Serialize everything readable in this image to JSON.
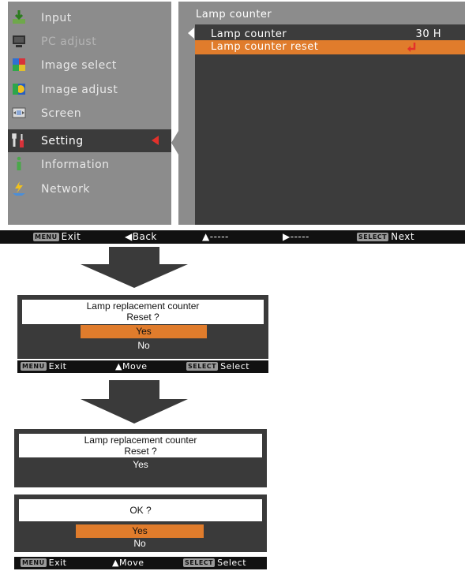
{
  "menu": {
    "items": [
      {
        "label": "Input",
        "icon": "input-icon",
        "state": "normal"
      },
      {
        "label": "PC adjust",
        "icon": "pc-adjust-icon",
        "state": "disabled"
      },
      {
        "label": "Image select",
        "icon": "image-select-icon",
        "state": "normal"
      },
      {
        "label": "Image adjust",
        "icon": "image-adjust-icon",
        "state": "normal"
      },
      {
        "label": "Screen",
        "icon": "screen-icon",
        "state": "normal"
      },
      {
        "label": "Setting",
        "icon": "setting-icon",
        "state": "active"
      },
      {
        "label": "Information",
        "icon": "information-icon",
        "state": "normal"
      },
      {
        "label": "Network",
        "icon": "network-icon",
        "state": "normal"
      }
    ]
  },
  "submenu": {
    "title": "Lamp counter",
    "rows": [
      {
        "label": "Lamp counter",
        "value": "30 H"
      },
      {
        "label": "Lamp counter  reset",
        "value": ""
      }
    ]
  },
  "status_bar": {
    "exit_key": "MENU",
    "exit_label": "Exit",
    "back_label": "Back",
    "updown_label": "-----",
    "right_label": "-----",
    "next_key": "SELECT",
    "next_label": "Next"
  },
  "dialog1": {
    "line1": "Lamp replacement counter",
    "line2": "Reset ?",
    "options": [
      "Yes",
      "No"
    ],
    "status": {
      "exit_key": "MENU",
      "exit_label": "Exit",
      "move_label": "Move",
      "select_key": "SELECT",
      "select_label": "Select"
    }
  },
  "dialog2": {
    "line1": "Lamp replacement counter",
    "line2": "Reset ?",
    "answer": "Yes"
  },
  "dialog3": {
    "question": "OK ?",
    "options": [
      "Yes",
      "No"
    ],
    "status": {
      "exit_key": "MENU",
      "exit_label": "Exit",
      "move_label": "Move",
      "select_key": "SELECT",
      "select_label": "Select"
    }
  },
  "colors": {
    "panel": "#8c8c8c",
    "dark": "#3c3c3c",
    "highlight": "#e07c2c",
    "marker": "#e3312b",
    "bar": "#111111"
  }
}
